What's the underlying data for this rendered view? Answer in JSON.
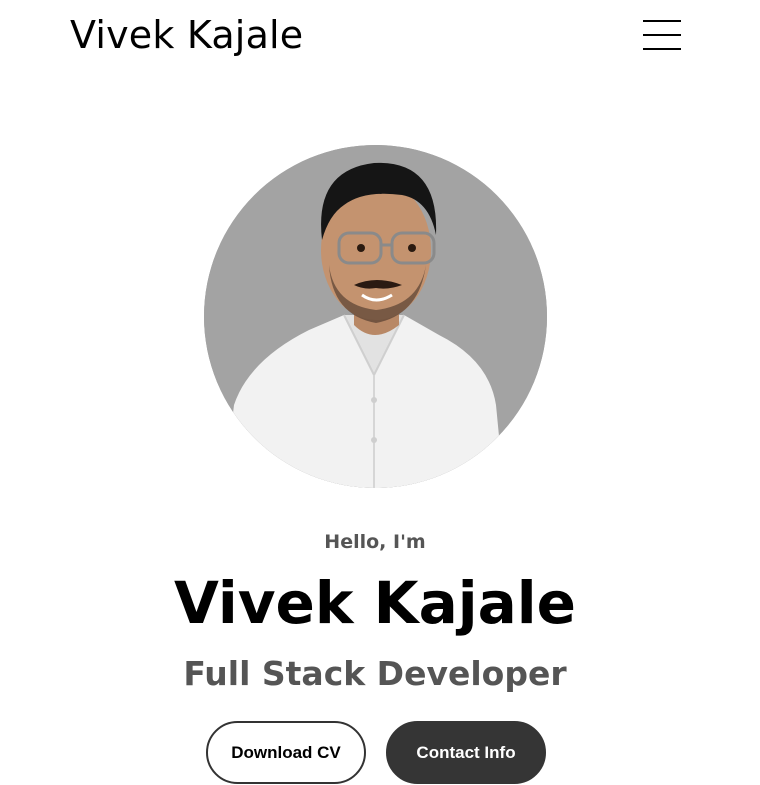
{
  "header": {
    "logo_text": "Vivek Kajale",
    "menu_icon": "hamburger-menu-icon"
  },
  "profile": {
    "photo_alt": "Profile photo",
    "background_color": "#a3a3a3"
  },
  "hero": {
    "greeting": "Hello, I'm",
    "name": "Vivek Kajale",
    "title": "Full Stack Developer"
  },
  "buttons": {
    "download_cv": "Download CV",
    "contact_info": "Contact Info"
  },
  "colors": {
    "dark_button": "#353535",
    "subtitle_text": "#555555"
  }
}
